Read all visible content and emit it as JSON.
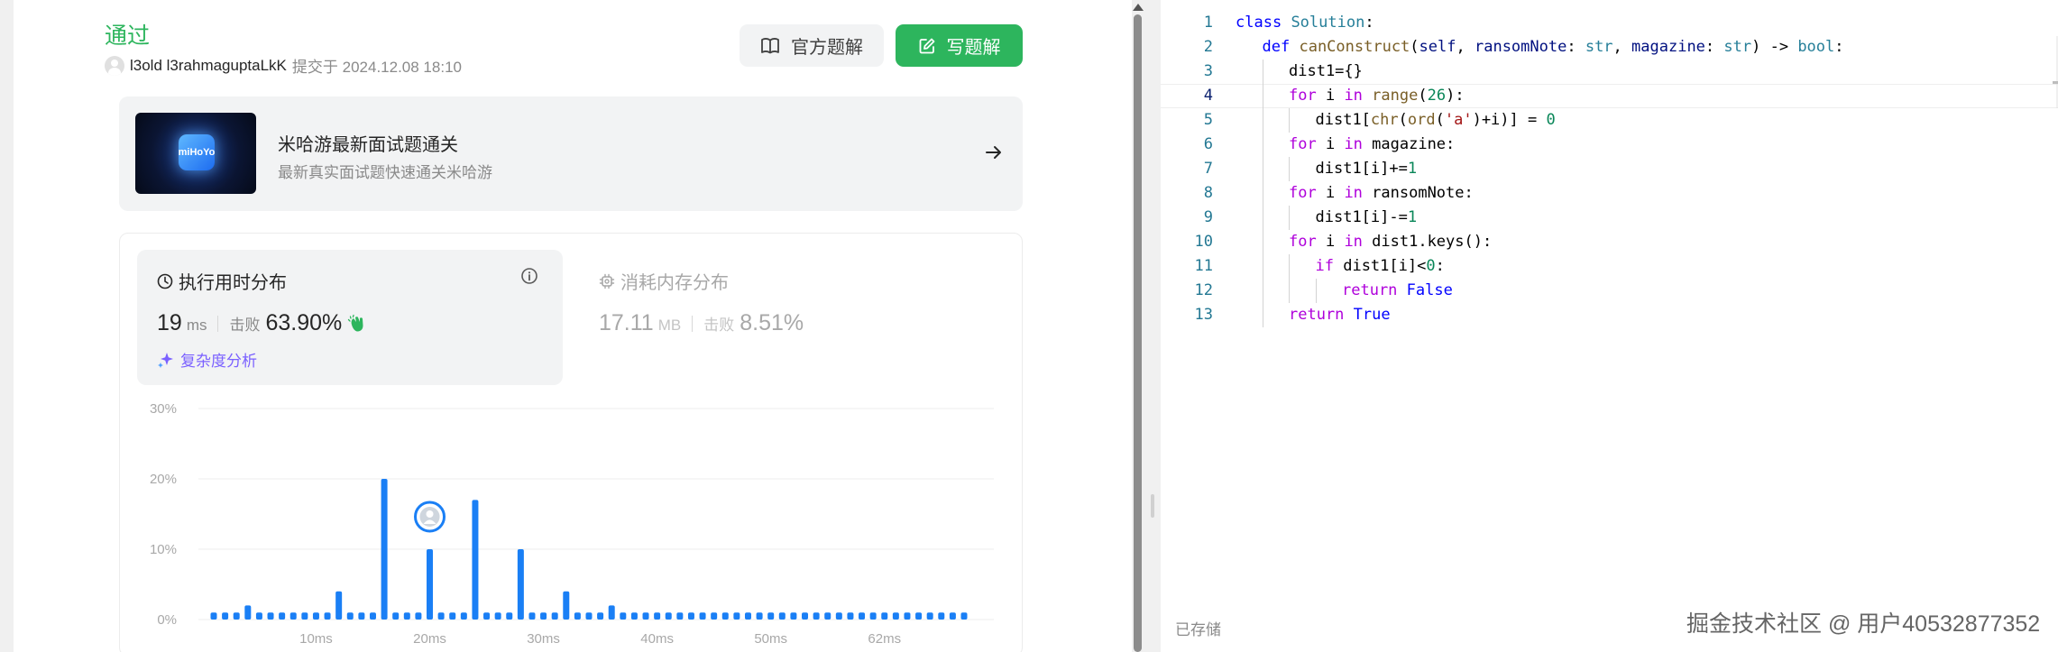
{
  "submission": {
    "status": "通过",
    "username": "l3old l3rahmaguptaLkK",
    "submitted_at": "提交于 2024.12.08 18:10",
    "official_solution_label": "官方题解",
    "write_solution_label": "写题解"
  },
  "promo": {
    "thumb_text": "miHoYo",
    "title": "米哈游最新面试题通关",
    "subtitle": "最新真实面试题快速通关米哈游"
  },
  "runtime": {
    "title": "执行用时分布",
    "value": "19",
    "unit": "ms",
    "beat_label": "击败",
    "beat_pct": "63.90%",
    "complexity_label": "复杂度分析"
  },
  "memory": {
    "title": "消耗内存分布",
    "value": "17.11",
    "unit": "MB",
    "beat_label": "击败",
    "beat_pct": "8.51%"
  },
  "chart_data": {
    "type": "bar",
    "ylim": [
      0,
      30
    ],
    "y_ticks": [
      "0%",
      "10%",
      "20%",
      "30%"
    ],
    "x_ticks": [
      {
        "label": "10ms",
        "at": 10
      },
      {
        "label": "20ms",
        "at": 20
      },
      {
        "label": "30ms",
        "at": 30
      },
      {
        "label": "40ms",
        "at": 40
      },
      {
        "label": "50ms",
        "at": 50
      },
      {
        "label": "62ms",
        "at": 60
      }
    ],
    "x": [
      1,
      2,
      3,
      4,
      5,
      6,
      7,
      8,
      9,
      10,
      11,
      12,
      13,
      14,
      15,
      16,
      17,
      18,
      19,
      20,
      21,
      22,
      23,
      24,
      25,
      26,
      27,
      28,
      29,
      30,
      31,
      32,
      33,
      34,
      35,
      36,
      37,
      38,
      39,
      40,
      41,
      42,
      43,
      44,
      45,
      46,
      47,
      48,
      49,
      50,
      51,
      52,
      53,
      54,
      55,
      56,
      57,
      58,
      59,
      60,
      61,
      62,
      63,
      64,
      65,
      66,
      67
    ],
    "values": [
      1,
      1,
      1,
      2,
      1,
      1,
      1,
      1,
      1,
      1,
      1,
      4,
      1,
      1,
      1,
      20,
      1,
      1,
      1,
      10,
      1,
      1,
      1,
      17,
      1,
      1,
      1,
      10,
      1,
      1,
      1,
      4,
      1,
      1,
      1,
      2,
      1,
      1,
      1,
      1,
      1,
      1,
      1,
      1,
      1,
      1,
      1,
      1,
      1,
      1,
      1,
      1,
      1,
      1,
      1,
      1,
      1,
      1,
      1,
      1,
      1,
      1,
      1,
      1,
      1,
      1,
      1
    ],
    "highlight_x": 20,
    "grid": true
  },
  "editor": {
    "active_line": 4,
    "lines": [
      {
        "n": "1",
        "indent": 0,
        "tokens": [
          [
            "kw",
            "class"
          ],
          [
            "",
            "&nbsp;"
          ],
          [
            "cls",
            "Solution"
          ],
          [
            "",
            ":"
          ]
        ]
      },
      {
        "n": "2",
        "indent": 1,
        "tokens": [
          [
            "kw",
            "def"
          ],
          [
            "",
            "&nbsp;"
          ],
          [
            "fn",
            "canConstruct"
          ],
          [
            "",
            "("
          ],
          [
            "par",
            "self"
          ],
          [
            "",
            ", "
          ],
          [
            "par",
            "ransomNote"
          ],
          [
            "",
            ": "
          ],
          [
            "cls",
            "str"
          ],
          [
            "",
            ", "
          ],
          [
            "par",
            "magazine"
          ],
          [
            "",
            ": "
          ],
          [
            "cls",
            "str"
          ],
          [
            "",
            ") -> "
          ],
          [
            "cls",
            "bool"
          ],
          [
            "",
            ":"
          ]
        ]
      },
      {
        "n": "3",
        "indent": 2,
        "tokens": [
          [
            "",
            "dist1={}"
          ]
        ]
      },
      {
        "n": "4",
        "indent": 2,
        "tokens": [
          [
            "ctl",
            "for"
          ],
          [
            "",
            " i "
          ],
          [
            "ctl",
            "in"
          ],
          [
            "",
            "&nbsp;"
          ],
          [
            "fn",
            "range"
          ],
          [
            "",
            "("
          ],
          [
            "num",
            "26"
          ],
          [
            "",
            "):"
          ]
        ]
      },
      {
        "n": "5",
        "indent": 3,
        "tokens": [
          [
            "",
            "dist1["
          ],
          [
            "fn",
            "chr"
          ],
          [
            "",
            "("
          ],
          [
            "fn",
            "ord"
          ],
          [
            "",
            "("
          ],
          [
            "str",
            "'a'"
          ],
          [
            "",
            ")+i)] = "
          ],
          [
            "num",
            "0"
          ]
        ]
      },
      {
        "n": "6",
        "indent": 2,
        "tokens": [
          [
            "ctl",
            "for"
          ],
          [
            "",
            " i "
          ],
          [
            "ctl",
            "in"
          ],
          [
            "",
            "",
            " magazine:"
          ]
        ]
      },
      {
        "n": "7",
        "indent": 3,
        "tokens": [
          [
            "",
            "dist1[i]+="
          ],
          [
            "num",
            "1"
          ]
        ]
      },
      {
        "n": "8",
        "indent": 2,
        "tokens": [
          [
            "ctl",
            "for"
          ],
          [
            "",
            " i "
          ],
          [
            "ctl",
            "in"
          ],
          [
            "",
            "",
            " ransomNote:"
          ]
        ]
      },
      {
        "n": "9",
        "indent": 3,
        "tokens": [
          [
            "",
            "dist1[i]-="
          ],
          [
            "num",
            "1"
          ]
        ]
      },
      {
        "n": "10",
        "indent": 2,
        "tokens": [
          [
            "ctl",
            "for"
          ],
          [
            "",
            " i "
          ],
          [
            "ctl",
            "in"
          ],
          [
            "",
            "",
            " dist1.keys():"
          ]
        ]
      },
      {
        "n": "11",
        "indent": 3,
        "tokens": [
          [
            "ctl",
            "if"
          ],
          [
            "",
            "",
            " dist1[i]<"
          ],
          [
            "num",
            "0"
          ],
          [
            "",
            ":"
          ]
        ]
      },
      {
        "n": "12",
        "indent": 4,
        "tokens": [
          [
            "ctl",
            "return"
          ],
          [
            "",
            "&nbsp;"
          ],
          [
            "kw",
            "False"
          ]
        ]
      },
      {
        "n": "13",
        "indent": 2,
        "tokens": [
          [
            "ctl",
            "return"
          ],
          [
            "",
            "&nbsp;"
          ],
          [
            "kw",
            "True"
          ]
        ]
      }
    ],
    "saved_label": "已存储"
  },
  "watermark": "掘金技术社区 @ 用户40532877352",
  "colors": {
    "accent_green": "#2db55d",
    "bar_blue": "#1a7ff5",
    "complexity_purple": "#7b61ff"
  }
}
